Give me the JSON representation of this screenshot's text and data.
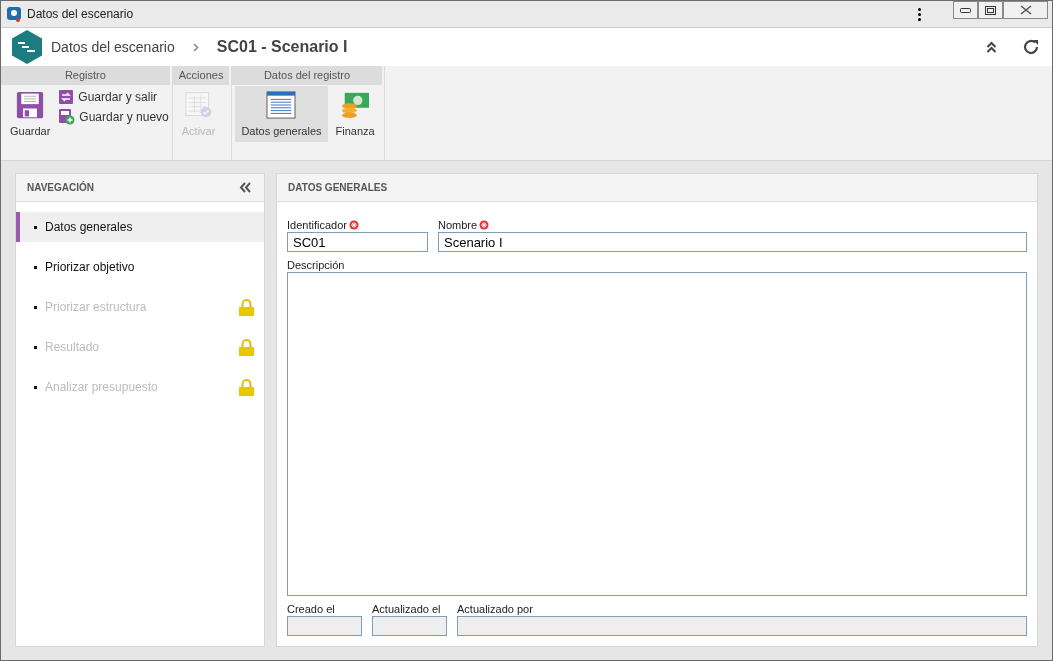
{
  "window": {
    "title": "Datos del escenario"
  },
  "header": {
    "breadcrumb": "Datos del escenario",
    "title": "SC01 - Scenario I"
  },
  "ribbon": [
    {
      "label": "Registro",
      "buttons": [
        {
          "kind": "large",
          "label": "Guardar",
          "disabled": false,
          "selected": false
        },
        {
          "kind": "small",
          "label": "Guardar y salir",
          "disabled": false,
          "selected": false
        },
        {
          "kind": "small",
          "label": "Guardar y nuevo",
          "disabled": false,
          "selected": false
        }
      ]
    },
    {
      "label": "Acciones",
      "buttons": [
        {
          "kind": "large",
          "label": "Activar",
          "disabled": true,
          "selected": false
        }
      ]
    },
    {
      "label": "Datos del registro",
      "buttons": [
        {
          "kind": "large",
          "label": "Datos generales",
          "disabled": false,
          "selected": true
        },
        {
          "kind": "large",
          "label": "Finanza",
          "disabled": false,
          "selected": false
        }
      ]
    }
  ],
  "navigation": {
    "title": "NAVEGACIÓN",
    "items": [
      {
        "label": "Datos generales",
        "selected": true,
        "disabled": false
      },
      {
        "label": "Priorizar objetivo",
        "selected": false,
        "disabled": false
      },
      {
        "label": "Priorizar estructura",
        "selected": false,
        "disabled": true
      },
      {
        "label": "Resultado",
        "selected": false,
        "disabled": true
      },
      {
        "label": "Analizar presupuesto",
        "selected": false,
        "disabled": true
      }
    ]
  },
  "form": {
    "title": "DATOS GENERALES",
    "fields": [
      {
        "kind": "text",
        "label": "Identificador",
        "value": "SC01",
        "required": true
      },
      {
        "kind": "text",
        "label": "Nombre",
        "value": "Scenario I",
        "required": true
      },
      {
        "kind": "textarea",
        "label": "Descripción",
        "required": false
      },
      {
        "kind": "readonly",
        "label": "Creado el",
        "required": false
      },
      {
        "kind": "readonly",
        "label": "Actualizado el",
        "required": false
      },
      {
        "kind": "readonly",
        "label": "Actualizado por",
        "required": false
      }
    ]
  }
}
